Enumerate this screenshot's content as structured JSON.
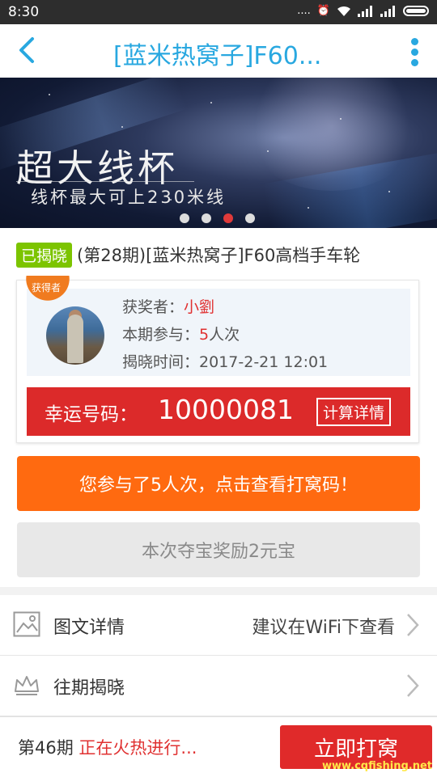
{
  "status_bar": {
    "time": "8:30",
    "signal": "....",
    "wifi_icon": "wifi-icon",
    "battery_icon": "battery-icon"
  },
  "header": {
    "title": "[蓝米热窝子]F60...",
    "back_icon": "back-arrow-icon",
    "more_icon": "more-vertical-icon"
  },
  "banner": {
    "headline": "超大线杯",
    "subline": "线杯最大可上230米线",
    "dots_count": 4,
    "active_dot": 3
  },
  "product": {
    "status_tag": "已揭晓",
    "name": "(第28期)[蓝米热窝子]F60高档手车轮"
  },
  "winner": {
    "badge": "获得者",
    "winner_label": "获奖者：",
    "winner_name": "小劉",
    "participation_label": "本期参与：",
    "participation_count": "5",
    "participation_unit": "人次",
    "reveal_label": "揭晓时间：",
    "reveal_time": "2017-2-21 12:01",
    "lucky_label": "幸运号码：",
    "lucky_number": "10000081",
    "calc_button": "计算详情"
  },
  "actions": {
    "view_codes": "您参与了5人次，点击查看打窝码！",
    "reward": "本次夺宝奖励2元宝"
  },
  "list": [
    {
      "label": "图文详情",
      "hint": "建议在WiFi下查看",
      "icon": "image-icon"
    },
    {
      "label": "往期揭晓",
      "hint": "",
      "icon": "crown-icon"
    }
  ],
  "bottom": {
    "period": "第46期",
    "status": "正在火热进行...",
    "buy_button": "立即打窝"
  },
  "watermark": "www.cqfishing.net",
  "colors": {
    "accent_blue": "#29a8e0",
    "red": "#dc2a2a",
    "orange": "#ff6a10",
    "green": "#7cc400"
  }
}
